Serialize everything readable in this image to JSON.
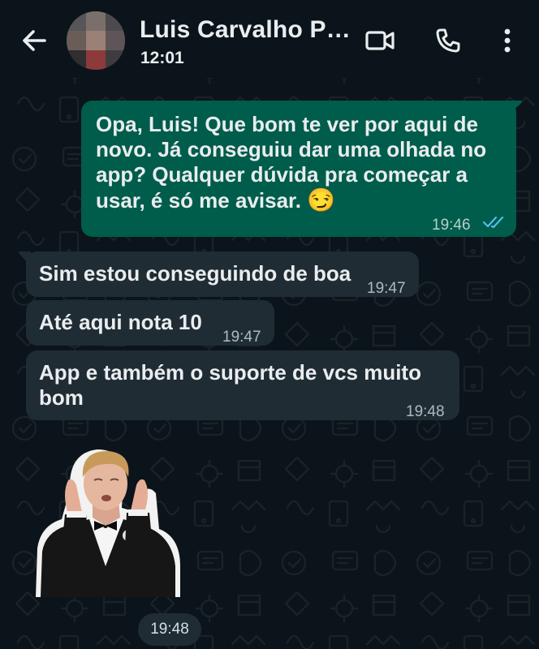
{
  "header": {
    "back_icon": "arrow-left-icon",
    "contact_name": "Luis Carvalho Pis…",
    "status": "12:01",
    "actions": {
      "video_icon": "video-camera-icon",
      "call_icon": "phone-icon",
      "menu_icon": "more-vertical-icon"
    }
  },
  "colors": {
    "background": "#0b141a",
    "outgoing_bubble": "#005c4b",
    "incoming_bubble": "#202c33",
    "read_ticks": "#53bdeb",
    "text": "#e9edef"
  },
  "messages": [
    {
      "direction": "outgoing",
      "lines": [
        "Opa, Luis! Que bom te ver por aqui de",
        "novo. Já conseguiu dar uma olhada no",
        "app? Qualquer dúvida pra começar a",
        "usar, é só me avisar."
      ],
      "emoji": "😏",
      "time": "19:46",
      "status_icon": "double-check-read-icon"
    },
    {
      "direction": "incoming",
      "text": "Sim estou conseguindo de boa",
      "time": "19:47"
    },
    {
      "direction": "incoming",
      "text": "Até aqui nota 10",
      "time": "19:47"
    },
    {
      "direction": "incoming",
      "lines": [
        "App e também o suporte de vcs muito",
        "bom"
      ],
      "time": "19:48"
    },
    {
      "direction": "incoming",
      "type": "sticker",
      "sticker_icon": "clapping-man-sticker",
      "time": "19:48"
    }
  ]
}
